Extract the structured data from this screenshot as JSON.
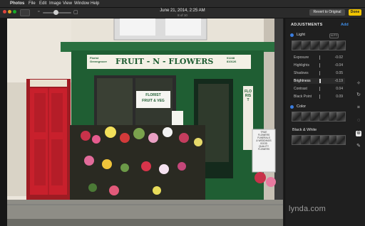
{
  "menubar": {
    "apple_icon": "apple-icon",
    "items": [
      "Photos",
      "File",
      "Edit",
      "Image",
      "View",
      "Window",
      "Help"
    ]
  },
  "toolbar": {
    "date": "June 21, 2014, 2:25 AM",
    "count": "8 of 10",
    "zoom_level": 0.35,
    "revert_label": "Revert to Original",
    "done_label": "Done"
  },
  "photo": {
    "sign_small_left": "Florist\nGreengrocer",
    "sign_main": "FRUIT - N - FLOWERS",
    "sign_phone": "01248\n810126",
    "window_sign": "FLORIST\nFRUIT & VEG",
    "vertical_sign": "FLORIST",
    "placard": "TRUE\nFLOWERS\nFUNERALS\n& WEDDINGS\nGOOD\nQUALITY\nFLOWERS"
  },
  "panel": {
    "title": "ADJUSTMENTS",
    "add_label": "Add",
    "light_label": "Light",
    "auto_label": "AUTO",
    "color_label": "Color",
    "bw_label": "Black & White",
    "sliders": [
      {
        "label": "Exposure",
        "value": "-0.02"
      },
      {
        "label": "Highlights",
        "value": "-0.04"
      },
      {
        "label": "Shadows",
        "value": "0.05"
      },
      {
        "label": "Brightness",
        "value": "-0.19"
      },
      {
        "label": "Contrast",
        "value": "0.04"
      },
      {
        "label": "Black Point",
        "value": "0.09"
      }
    ]
  },
  "watermark": "lynda.com",
  "colors": {
    "accent": "#3f8ee8",
    "done": "#f0c400",
    "shopfront": "#1f5e33",
    "door": "#c8202c"
  }
}
